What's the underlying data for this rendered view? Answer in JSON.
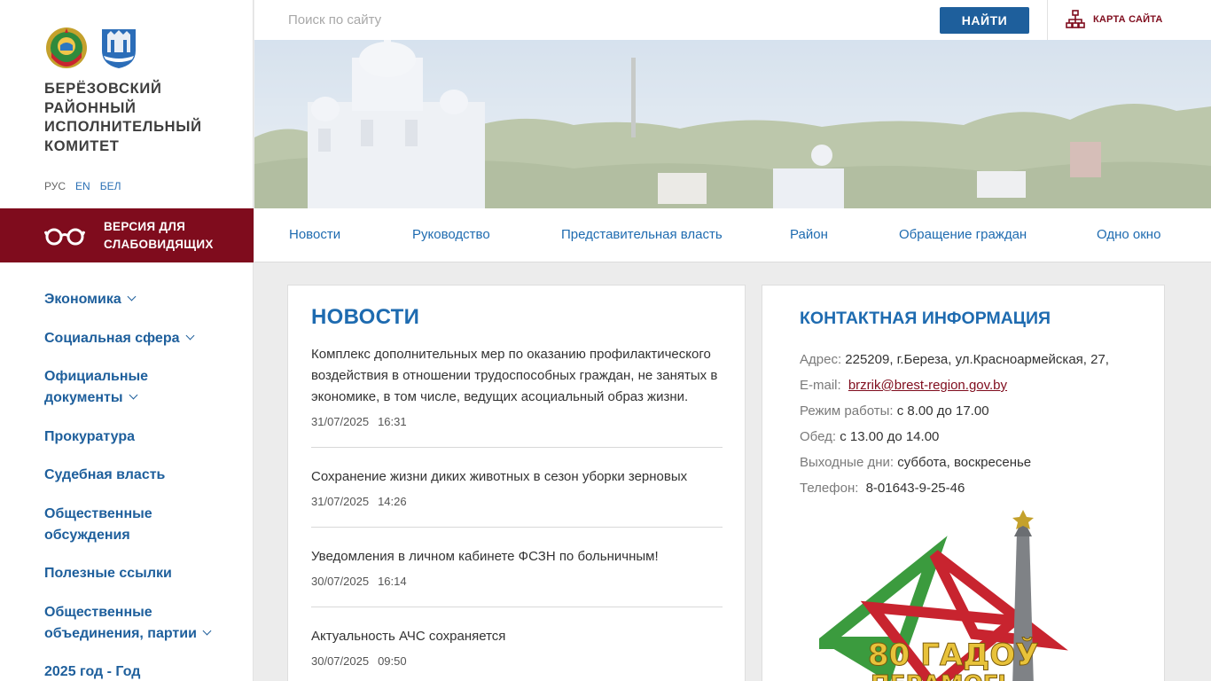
{
  "sidebar": {
    "org_title": "БЕРЁЗОВСКИЙ РАЙОННЫЙ ИСПОЛНИТЕЛЬНЫЙ КОМИТЕТ",
    "langs": [
      "РУС",
      "EN",
      "БЕЛ"
    ],
    "low_vision_label": "ВЕРСИЯ ДЛЯ СЛАБОВИДЯЩИХ",
    "menu": [
      {
        "label": "Экономика",
        "has_submenu": true
      },
      {
        "label": "Социальная сфера",
        "has_submenu": true
      },
      {
        "label": "Официальные документы",
        "has_submenu": true
      },
      {
        "label": "Прокуратура",
        "has_submenu": false
      },
      {
        "label": "Судебная власть",
        "has_submenu": false
      },
      {
        "label": "Общественные обсуждения",
        "has_submenu": false
      },
      {
        "label": "Полезные ссылки",
        "has_submenu": false
      },
      {
        "label": "Общественные объединения, партии",
        "has_submenu": true
      },
      {
        "label": "2025 год - Год",
        "has_submenu": false
      }
    ]
  },
  "header": {
    "search_placeholder": "Поиск по сайту",
    "search_button": "НАЙТИ",
    "sitemap_label": "КАРТА САЙТА"
  },
  "nav": [
    "Новости",
    "Руководство",
    "Представительная власть",
    "Район",
    "Обращение граждан",
    "Одно окно"
  ],
  "news": {
    "title": "НОВОСТИ",
    "items": [
      {
        "title": "Комплекс дополнительных мер по оказанию профилактического воздействия в отношении трудоспособных граждан, не занятых в экономике, в том числе, ведущих асоциальный образ жизни.",
        "date": "31/07/2025",
        "time": "16:31"
      },
      {
        "title": "Сохранение жизни диких животных в сезон уборки зерновых",
        "date": "31/07/2025",
        "time": "14:26"
      },
      {
        "title": "Уведомления в личном кабинете ФСЗН по больничным!",
        "date": "30/07/2025",
        "time": "16:14"
      },
      {
        "title": "Актуальность АЧС сохраняется",
        "date": "30/07/2025",
        "time": "09:50"
      }
    ]
  },
  "contacts": {
    "title": "КОНТАКТНАЯ ИНФОРМАЦИЯ",
    "address_label": "Адрес:",
    "address": "225209, г.Береза, ул.Красноармейская, 27,",
    "email_label": "E-mail:",
    "email": "brzrik@brest-region.gov.by",
    "hours_label": "Режим работы:",
    "hours": "с 8.00 до 17.00",
    "lunch_label": "Обед:",
    "lunch": "с 13.00 до 14.00",
    "weekend_label": "Выходные дни:",
    "weekend": "суббота, воскресенье",
    "phone_label": "Телефон:",
    "phone": "8-01643-9-25-46"
  },
  "banner_text": {
    "line1": "80 ГАДОЎ",
    "line2": "ПЕРАМОГІ"
  },
  "colors": {
    "primary_blue": "#1e5f9c",
    "maroon": "#7f0c1d",
    "link_blue": "#1e6bb0"
  }
}
